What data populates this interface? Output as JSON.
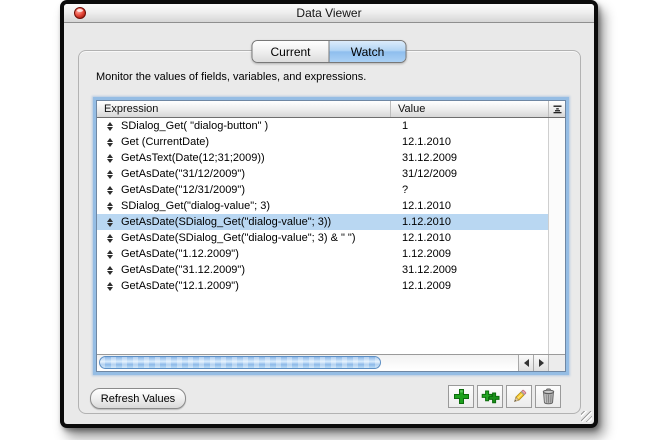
{
  "window": {
    "title": "Data Viewer"
  },
  "tabs": [
    {
      "label": "Current",
      "selected": false
    },
    {
      "label": "Watch",
      "selected": true
    }
  ],
  "description": "Monitor the values of fields, variables, and expressions.",
  "table": {
    "columns": [
      "Expression",
      "Value"
    ],
    "rows": [
      {
        "expression": "SDialog_Get( \"dialog-button\" )",
        "value": "1",
        "selected": false
      },
      {
        "expression": "Get (CurrentDate)",
        "value": "12.1.2010",
        "selected": false
      },
      {
        "expression": "GetAsText(Date(12;31;2009))",
        "value": "31.12.2009",
        "selected": false
      },
      {
        "expression": "GetAsDate(\"31/12/2009\")",
        "value": "31/12/2009",
        "selected": false
      },
      {
        "expression": "GetAsDate(\"12/31/2009\")",
        "value": "?",
        "selected": false
      },
      {
        "expression": "SDialog_Get(\"dialog-value\"; 3)",
        "value": "12.1.2010",
        "selected": false
      },
      {
        "expression": "GetAsDate(SDialog_Get(\"dialog-value\"; 3))",
        "value": "1.12.2010",
        "selected": true
      },
      {
        "expression": "GetAsDate(SDialog_Get(\"dialog-value\"; 3) & \" \")",
        "value": "12.1.2010",
        "selected": false
      },
      {
        "expression": "GetAsDate(\"1.12.2009\")",
        "value": "1.12.2009",
        "selected": false
      },
      {
        "expression": "GetAsDate(\"31.12.2009\")",
        "value": "31.12.2009",
        "selected": false
      },
      {
        "expression": "GetAsDate(\"12.1.2009\")",
        "value": "12.1.2009",
        "selected": false
      }
    ]
  },
  "buttons": {
    "refresh_label": "Refresh Values"
  },
  "action_bar": {
    "buttons": [
      {
        "name": "add-expression",
        "icon": "plus-icon"
      },
      {
        "name": "duplicate-expression",
        "icon": "double-plus-icon"
      },
      {
        "name": "edit-expression",
        "icon": "pencil-icon"
      },
      {
        "name": "delete-expression",
        "icon": "trash-icon"
      }
    ]
  },
  "icons": {
    "titlebar_close": "close-icon",
    "row_drag": "up-down-arrows-icon",
    "header_corner": "sort-icon"
  },
  "colors": {
    "selection_blue": "#b9d7f2",
    "tab_active_blue": "#9fc7f0",
    "focus_ring_blue": "#94bce4",
    "plus_green": "#1da11d",
    "pencil_yellow": "#f2c32a",
    "trash_gray": "#9b9b9b",
    "close_red": "#d43a2c",
    "window_gray": "#e9e9e9"
  }
}
